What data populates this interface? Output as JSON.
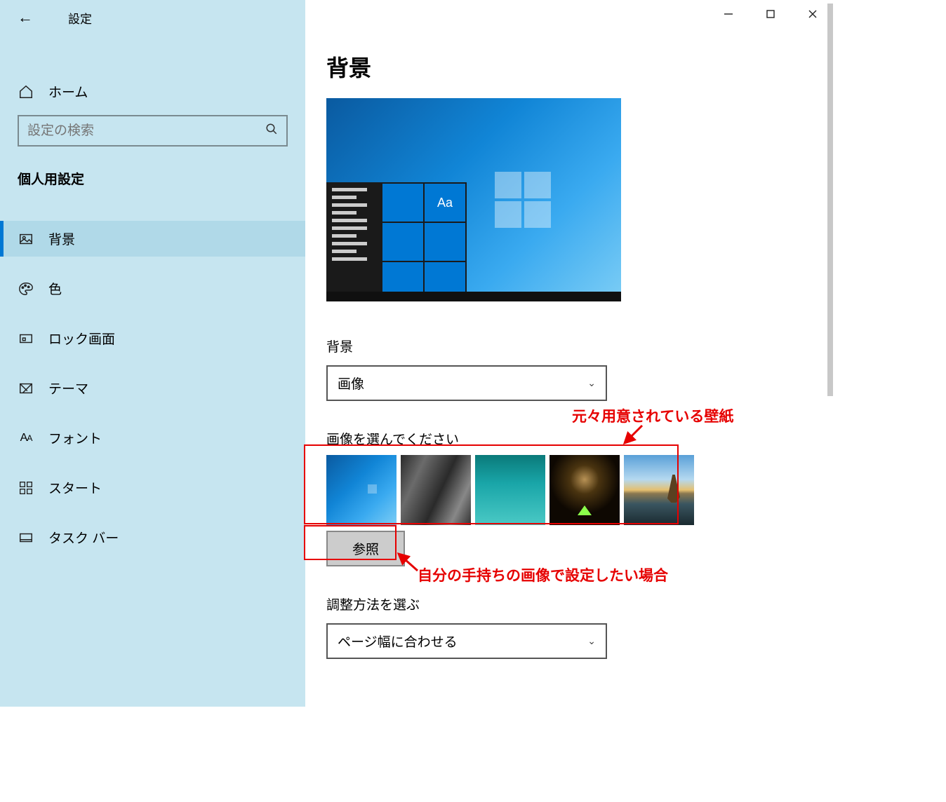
{
  "titlebar": {
    "title": "設定"
  },
  "sidebar": {
    "home": "ホーム",
    "search_placeholder": "設定の検索",
    "section": "個人用設定",
    "items": [
      {
        "label": "背景"
      },
      {
        "label": "色"
      },
      {
        "label": "ロック画面"
      },
      {
        "label": "テーマ"
      },
      {
        "label": "フォント"
      },
      {
        "label": "スタート"
      },
      {
        "label": "タスク バー"
      }
    ]
  },
  "main": {
    "page_title": "背景",
    "preview_tile_text": "Aa",
    "background_label": "背景",
    "background_value": "画像",
    "choose_image_label": "画像を選んでください",
    "browse_label": "参照",
    "fit_label": "調整方法を選ぶ",
    "fit_value": "ページ幅に合わせる"
  },
  "annotations": {
    "preset_wallpapers": "元々用意されている壁紙",
    "own_image": "自分の手持ちの画像で設定したい場合"
  }
}
